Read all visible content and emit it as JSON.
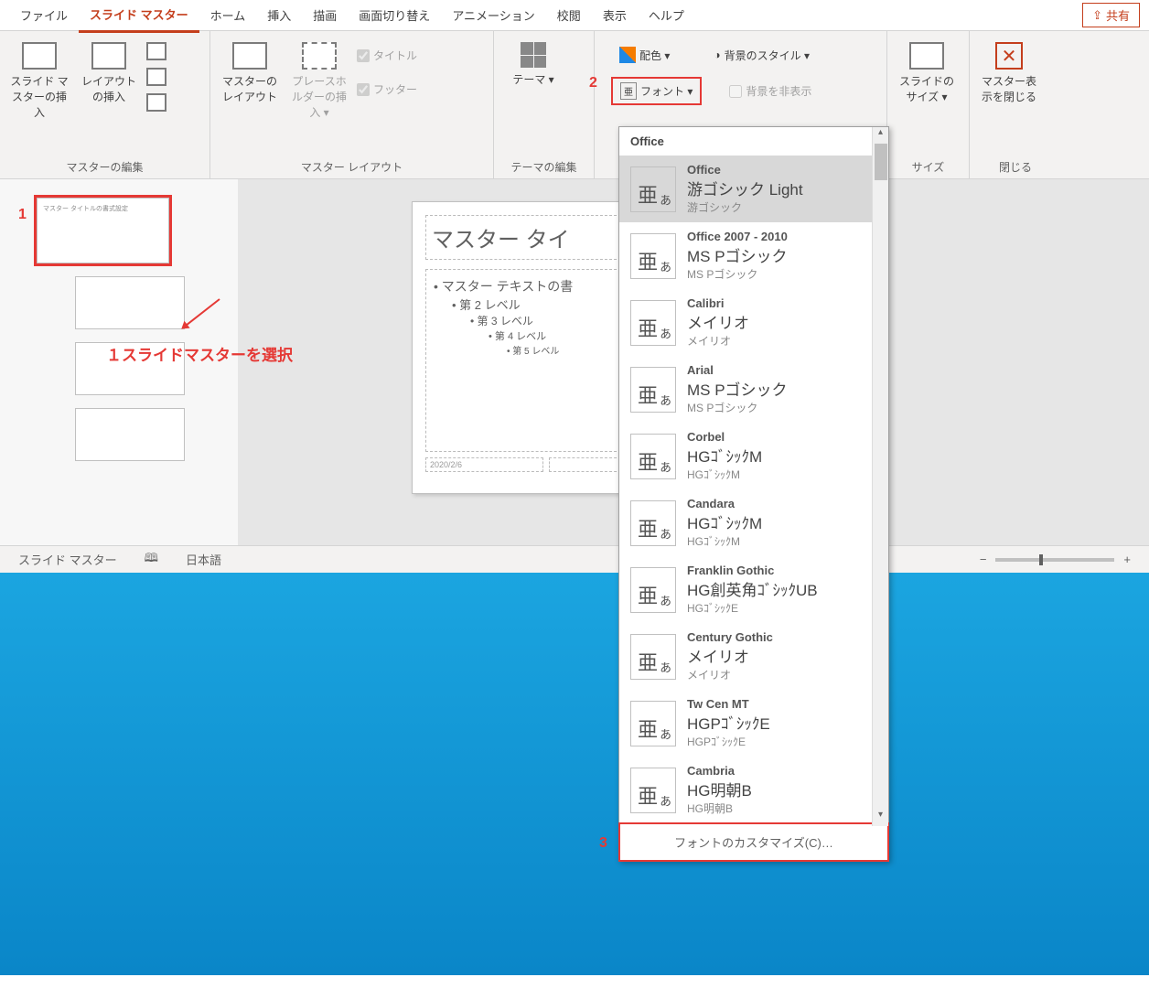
{
  "tabs": [
    "ファイル",
    "スライド マスター",
    "ホーム",
    "挿入",
    "描画",
    "画面切り替え",
    "アニメーション",
    "校閲",
    "表示",
    "ヘルプ"
  ],
  "active_tab": 1,
  "share": "共有",
  "ribbon": {
    "g1": {
      "btn1": "スライド マスターの挿入",
      "btn2": "レイアウトの挿入",
      "label": "マスターの編集"
    },
    "g2": {
      "btn1": "マスターのレイアウト",
      "btn2": "プレースホルダーの挿入 ▾",
      "cb1": "タイトル",
      "cb2": "フッター",
      "label": "マスター レイアウト"
    },
    "g3": {
      "btn1": "テーマ ▾",
      "label": "テーマの編集"
    },
    "g4": {
      "color": "配色 ▾",
      "font": "フォント ▾",
      "bgstyle": "背景のスタイル ▾",
      "hidebg": "背景を非表示"
    },
    "g5": {
      "btn": "スライドのサイズ ▾",
      "label": "サイズ"
    },
    "g6": {
      "btn": "マスター表示を閉じる",
      "label": "閉じる"
    }
  },
  "annot": {
    "n1": "1",
    "n2": "2",
    "n3": "3",
    "text1": "１スライドマスターを選択"
  },
  "slide": {
    "title": "マスター タイ",
    "body": [
      "マスター テキストの書",
      "第 2 レベル",
      "第 3 レベル",
      "第 4 レベル",
      "第 5 レベル"
    ],
    "date": "2020/2/6"
  },
  "thumb_title": "マスター タイトルの書式設定",
  "status": {
    "left": "スライド マスター",
    "lang": "日本語"
  },
  "fontmenu": {
    "hdr": "Office",
    "items": [
      {
        "n1": "Office",
        "n2": "游ゴシック Light",
        "n3": "游ゴシック",
        "sel": true
      },
      {
        "n1": "Office 2007 - 2010",
        "n2": "MS Pゴシック",
        "n3": "MS Pゴシック"
      },
      {
        "n1": "Calibri",
        "n2": "メイリオ",
        "n3": "メイリオ"
      },
      {
        "n1": "Arial",
        "n2": "MS Pゴシック",
        "n3": "MS Pゴシック"
      },
      {
        "n1": "Corbel",
        "n2": "HGｺﾞｼｯｸM",
        "n3": "HGｺﾞｼｯｸM"
      },
      {
        "n1": "Candara",
        "n2": "HGｺﾞｼｯｸM",
        "n3": "HGｺﾞｼｯｸM"
      },
      {
        "n1": "Franklin Gothic",
        "n2": "HG創英角ｺﾞｼｯｸUB",
        "n3": "HGｺﾞｼｯｸE"
      },
      {
        "n1": "Century Gothic",
        "n2": "メイリオ",
        "n3": "メイリオ"
      },
      {
        "n1": "Tw Cen MT",
        "n2": "HGPｺﾞｼｯｸE",
        "n3": "HGPｺﾞｼｯｸE"
      },
      {
        "n1": "Cambria",
        "n2": "HG明朝B",
        "n3": "HG明朝B"
      }
    ],
    "customize": "フォントのカスタマイズ(C)…",
    "sample": "亜ぁ"
  }
}
